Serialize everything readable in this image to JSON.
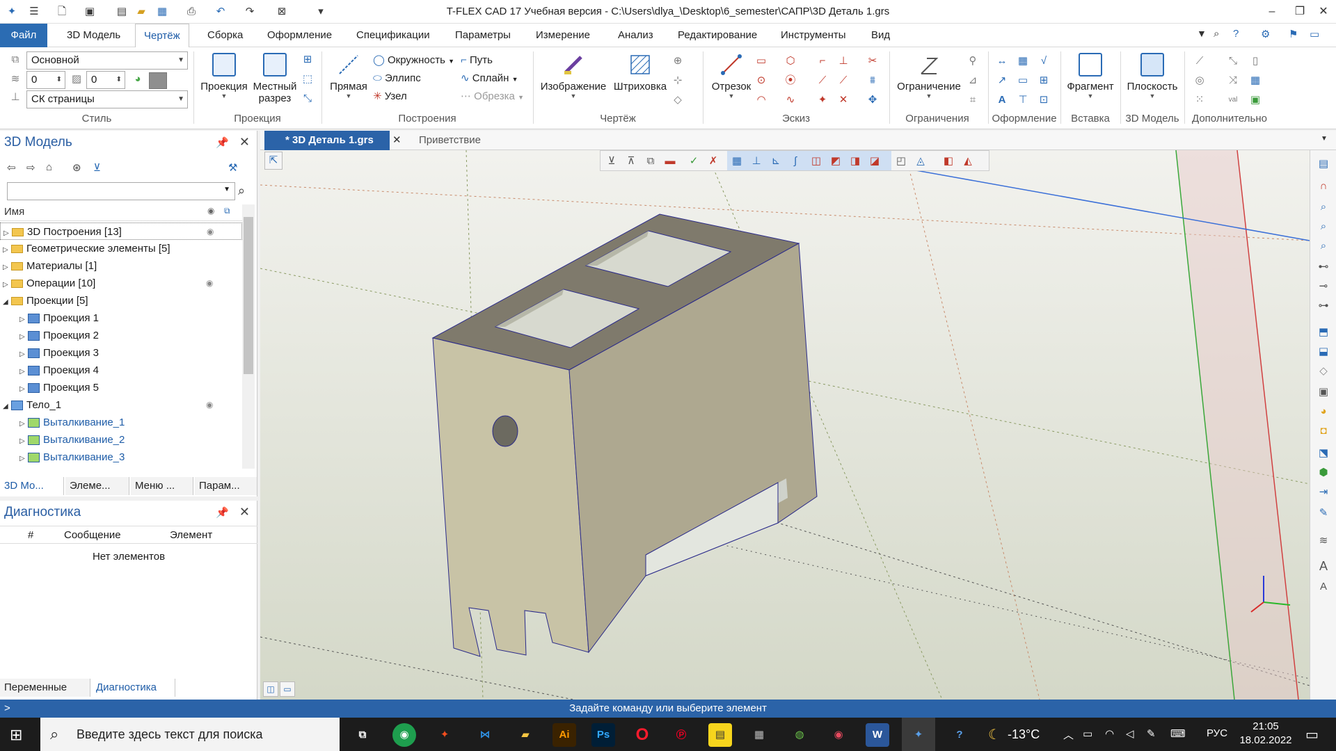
{
  "app": {
    "title": "T-FLEX CAD 17 Учебная версия - C:\\Users\\dlya_\\Desktop\\6_semester\\САПР\\3D Деталь 1.grs",
    "window_buttons": [
      "–",
      "❐",
      "✕"
    ]
  },
  "menu": {
    "tabs": [
      "Файл",
      "3D Модель",
      "Чертёж",
      "Сборка",
      "Оформление",
      "Спецификации",
      "Параметры",
      "Измерение",
      "Анализ",
      "Редактирование",
      "Инструменты",
      "Вид"
    ],
    "active": "Чертёж"
  },
  "ribbon": {
    "style": {
      "layer_combo": "Основной",
      "line_value1": "0",
      "line_value2": "0",
      "cs_combo": "СК страницы",
      "label": "Стиль"
    },
    "projection": {
      "projection_btn": "Проекция",
      "local_section_btn_line1": "Местный",
      "local_section_btn_line2": "разрез",
      "label": "Проекция"
    },
    "construction": {
      "line_btn": "Прямая",
      "circle": "Окружность",
      "ellipse": "Эллипс",
      "node": "Узел",
      "path": "Путь",
      "spline": "Сплайн",
      "trim": "Обрезка",
      "label": "Построения"
    },
    "drawing": {
      "image_btn": "Изображение",
      "hatch_btn": "Штриховка",
      "label": "Чертёж"
    },
    "sketch": {
      "segment_btn": "Отрезок",
      "label": "Эскиз"
    },
    "constraints": {
      "constraint_btn": "Ограничение",
      "label": "Ограничения"
    },
    "formatting": {
      "label": "Оформление"
    },
    "insert": {
      "fragment_btn": "Фрагмент",
      "label": "Вставка"
    },
    "model3d": {
      "plane_btn": "Плоскость",
      "label": "3D Модель"
    },
    "extra": {
      "label": "Дополнительно"
    }
  },
  "model_panel": {
    "title": "3D Модель",
    "column_name": "Имя",
    "tree": [
      {
        "label": "3D Построения [13]",
        "icon": "folder",
        "level": 0,
        "expanded": false,
        "blue": false
      },
      {
        "label": "Геометрические элементы [5]",
        "icon": "folder",
        "level": 0,
        "expanded": false,
        "blue": false
      },
      {
        "label": "Материалы [1]",
        "icon": "folder",
        "level": 0,
        "expanded": false,
        "blue": false
      },
      {
        "label": "Операции [10]",
        "icon": "folder",
        "level": 0,
        "expanded": false,
        "blue": false
      },
      {
        "label": "Проекции [5]",
        "icon": "folder",
        "level": 0,
        "expanded": true,
        "blue": false
      },
      {
        "label": "Проекция 1",
        "icon": "projection",
        "level": 1,
        "expanded": false,
        "blue": false
      },
      {
        "label": "Проекция 2",
        "icon": "projection",
        "level": 1,
        "expanded": false,
        "blue": false
      },
      {
        "label": "Проекция 3",
        "icon": "projection",
        "level": 1,
        "expanded": false,
        "blue": false
      },
      {
        "label": "Проекция 4",
        "icon": "projection",
        "level": 1,
        "expanded": false,
        "blue": false
      },
      {
        "label": "Проекция 5",
        "icon": "projection",
        "level": 1,
        "expanded": false,
        "blue": false
      },
      {
        "label": "Тело_1",
        "icon": "body",
        "level": 0,
        "expanded": true,
        "blue": false
      },
      {
        "label": "Выталкивание_1",
        "icon": "extrude",
        "level": 1,
        "expanded": false,
        "blue": true
      },
      {
        "label": "Выталкивание_2",
        "icon": "extrude",
        "level": 1,
        "expanded": false,
        "blue": true
      },
      {
        "label": "Выталкивание_3",
        "icon": "extrude",
        "level": 1,
        "expanded": false,
        "blue": true
      }
    ],
    "bottom_tabs": [
      "3D Мо...",
      "Элеме...",
      "Меню ...",
      "Парам..."
    ]
  },
  "diag_panel": {
    "title": "Диагностика",
    "columns": [
      "#",
      "Сообщение",
      "Элемент"
    ],
    "empty_text": "Нет элементов",
    "bottom_tabs": [
      "Переменные",
      "Диагностика"
    ]
  },
  "doc_tabs": {
    "active": "* 3D Деталь 1.grs",
    "other": "Приветствие"
  },
  "status": {
    "prompt": "Задайте команду или выберите элемент",
    "left_mark": ">"
  },
  "taskbar": {
    "search_placeholder": "Введите здесь текст для поиска",
    "temperature": "-13°C",
    "language": "РУС",
    "time": "21:05",
    "date": "18.02.2022"
  }
}
